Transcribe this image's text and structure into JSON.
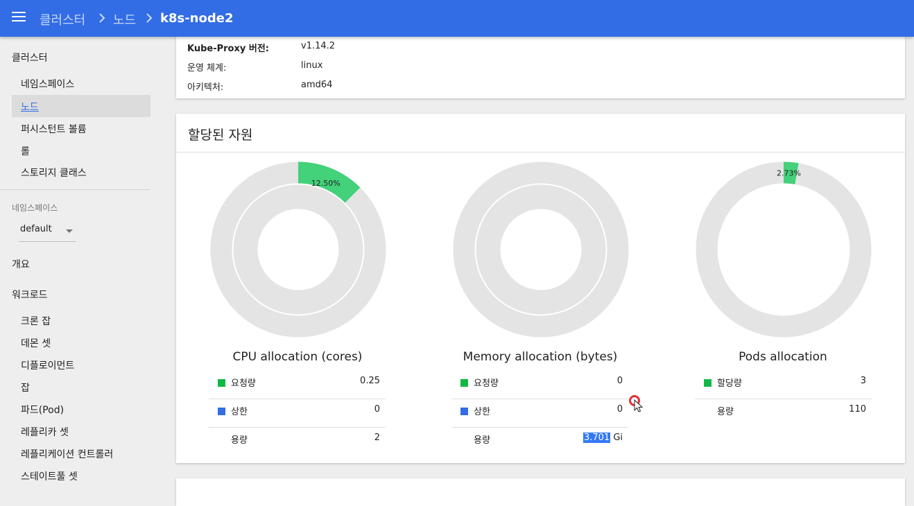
{
  "breadcrumb": {
    "items": [
      "클러스터",
      "노드"
    ],
    "current": "k8s-node2"
  },
  "sidebar": {
    "cluster_label": "클러스터",
    "cluster_items": [
      {
        "label": "네임스페이스",
        "active": false
      },
      {
        "label": "노드",
        "active": true
      },
      {
        "label": "퍼시스턴트 볼륨",
        "active": false
      },
      {
        "label": "롤",
        "active": false
      },
      {
        "label": "스토리지 클래스",
        "active": false
      }
    ],
    "namespace_label": "네임스페이스",
    "namespace_value": "default",
    "overview_label": "개요",
    "workloads_label": "워크로드",
    "workload_items": [
      "크론 잡",
      "데몬 셋",
      "디플로이먼트",
      "잡",
      "파드(Pod)",
      "레플리카 셋",
      "레플리케이션 컨트롤러",
      "스테이트풀 셋"
    ]
  },
  "info": {
    "rows": [
      {
        "key": "Kube-Proxy 버전:",
        "value": "v1.14.2"
      },
      {
        "key": "운영 체계:",
        "value": "linux"
      },
      {
        "key": "아키텍처:",
        "value": "amd64"
      }
    ]
  },
  "allocation": {
    "title": "할당된 자원",
    "accent_color": "#43d17a",
    "limit_color": "#326de6",
    "track_color": "#e4e4e4",
    "charts": [
      {
        "title": "CPU allocation (cores)",
        "requests_fraction": 0.125,
        "requests_label": "12.50%",
        "rows": [
          {
            "swatch": "requests",
            "label": "요청량",
            "value": "0.25"
          },
          {
            "swatch": "limits",
            "label": "상한",
            "value": "0"
          },
          {
            "swatch": "",
            "label": "용량",
            "value": "2"
          }
        ]
      },
      {
        "title": "Memory allocation (bytes)",
        "requests_fraction": 0,
        "requests_label": "",
        "rows": [
          {
            "swatch": "requests",
            "label": "요청량",
            "value": "0"
          },
          {
            "swatch": "limits",
            "label": "상한",
            "value": "0"
          },
          {
            "swatch": "",
            "label": "용량",
            "value": "3.701",
            "unit": "Gi"
          }
        ]
      },
      {
        "title": "Pods allocation",
        "requests_fraction": 0.0273,
        "requests_label": "2.73%",
        "rows": [
          {
            "swatch": "requests",
            "label": "할당량",
            "value": "3"
          },
          {
            "swatch": "",
            "label": "용량",
            "value": "110"
          }
        ]
      }
    ]
  }
}
